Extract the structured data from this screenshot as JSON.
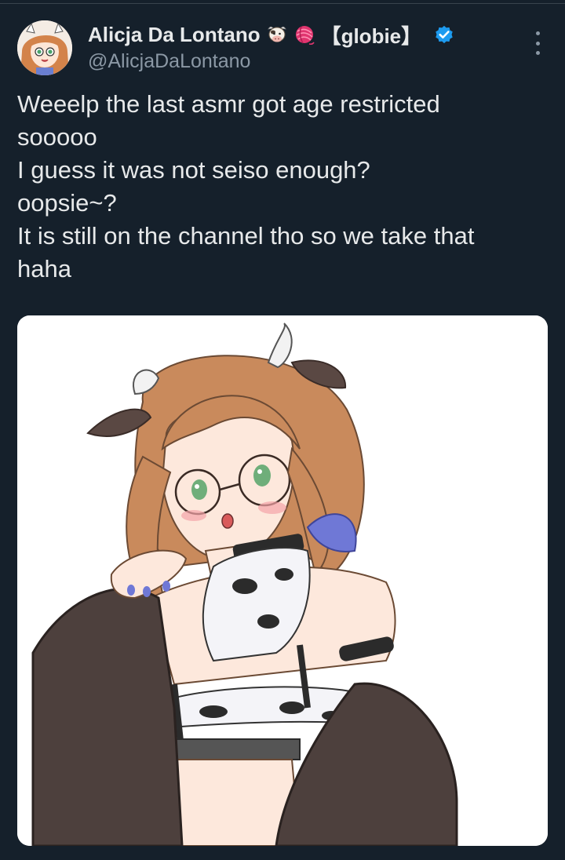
{
  "author": {
    "display_name": "Alicja Da Lontano",
    "name_emojis": [
      "cow-face-emoji",
      "yarn-ball-emoji"
    ],
    "name_suffix": "【globie】",
    "handle": "@AlicjaDaLontano",
    "verified": true
  },
  "tweet": {
    "text_lines": [
      "Weeelp the last asmr got age restricted",
      "sooooo",
      "I guess it was not seiso enough?",
      "oopsie~?",
      "It is still on the channel tho so we take that",
      "haha"
    ]
  },
  "media": {
    "type": "illustration",
    "description_icon": "cow-girl-illustration"
  },
  "colors": {
    "background": "#15202b",
    "primary_text": "#e7e9ea",
    "secondary_text": "#8b98a5",
    "verified_blue": "#1d9bf0"
  }
}
